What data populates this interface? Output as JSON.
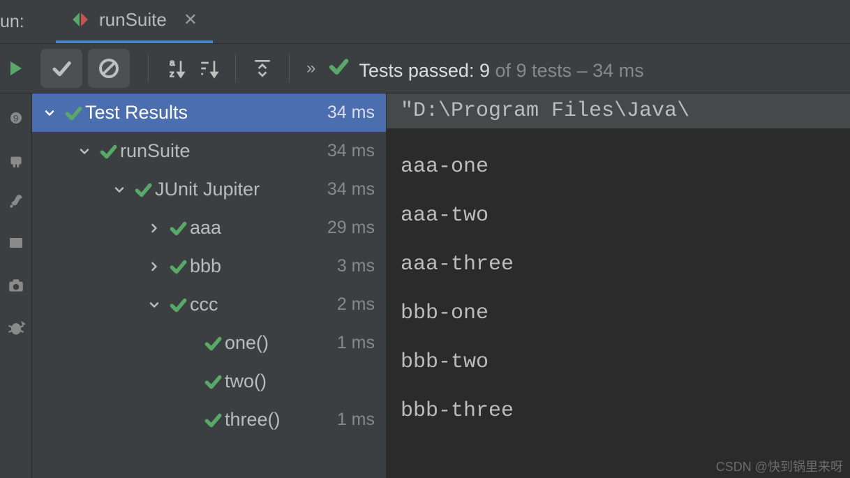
{
  "header": {
    "run_label": "un:",
    "tab_name": "runSuite"
  },
  "status": {
    "label": "Tests passed:",
    "passed": "9",
    "total_suffix": "of 9 tests – 34 ms"
  },
  "tree": [
    {
      "depth": 0,
      "chev": "down",
      "label": "Test Results",
      "time": "34 ms",
      "selected": true
    },
    {
      "depth": 1,
      "chev": "down",
      "label": "runSuite",
      "time": "34 ms"
    },
    {
      "depth": 2,
      "chev": "down",
      "label": "JUnit Jupiter",
      "time": "34 ms"
    },
    {
      "depth": 3,
      "chev": "right",
      "label": "aaa",
      "time": "29 ms"
    },
    {
      "depth": 3,
      "chev": "right",
      "label": "bbb",
      "time": "3 ms"
    },
    {
      "depth": 3,
      "chev": "down",
      "label": "ccc",
      "time": "2 ms"
    },
    {
      "depth": 4,
      "chev": "",
      "label": "one()",
      "time": "1 ms"
    },
    {
      "depth": 4,
      "chev": "",
      "label": "two()",
      "time": ""
    },
    {
      "depth": 4,
      "chev": "",
      "label": "three()",
      "time": "1 ms"
    }
  ],
  "console": {
    "header": "\"D:\\Program Files\\Java\\",
    "lines": [
      "aaa-one",
      "aaa-two",
      "aaa-three",
      "bbb-one",
      "bbb-two",
      "bbb-three"
    ]
  },
  "watermark": "CSDN @快到锅里来呀"
}
